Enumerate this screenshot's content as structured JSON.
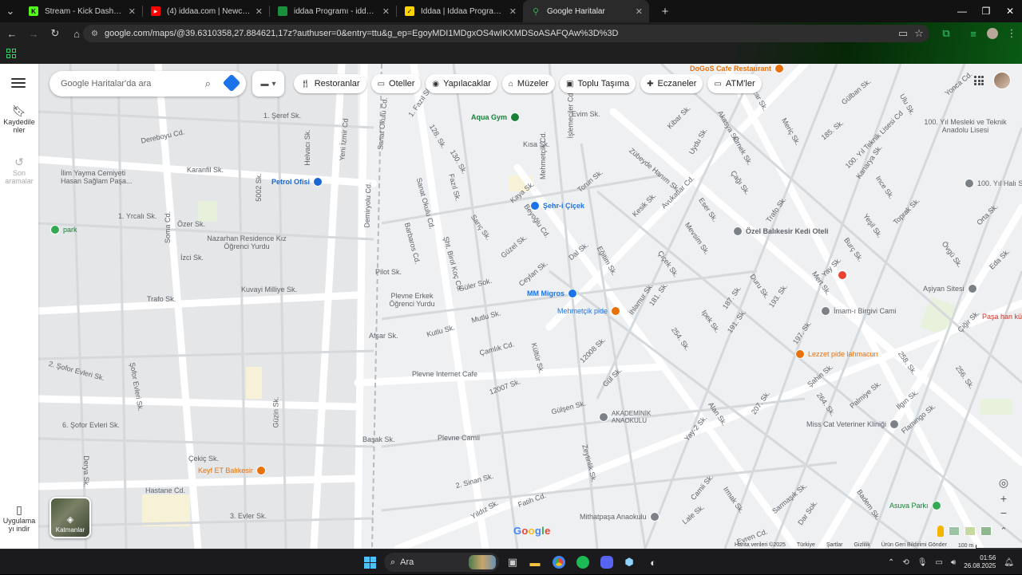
{
  "browser": {
    "tabs": [
      {
        "title": "Stream - Kick Dashboard",
        "fav_color": "#53fc18",
        "fav_glyph": "K",
        "active": false
      },
      {
        "title": "(4) iddaa.com | Newcastle (2-3)",
        "fav_color": "#ff0000",
        "fav_glyph": "▶",
        "active": false
      },
      {
        "title": "iddaa Programı - iddaa Bülten",
        "fav_color": "#1a8f3c",
        "fav_glyph": "",
        "active": false
      },
      {
        "title": "İddaa | İddaa Programı | Canlı İ...",
        "fav_color": "#ffd400",
        "fav_glyph": "✓",
        "active": false
      },
      {
        "title": "Google Haritalar",
        "fav_color": "#34a853",
        "fav_glyph": "",
        "active": true
      }
    ],
    "new_tab_label": "+",
    "url": "google.com/maps/@39.6310358,27.884621,17z?authuser=0&entry=ttu&g_ep=EgoyMDI1MDgxOS4wIKXMDSoASAFQAw%3D%3D"
  },
  "maps": {
    "rail": {
      "saved_label": "Kaydedilenler",
      "saved_l1": "Kaydedile",
      "saved_l2": "nler",
      "recent_l1": "Son",
      "recent_l2": "aramalar",
      "app_l1": "Uygulama",
      "app_l2": "yı indir"
    },
    "search_placeholder": "Google Haritalar'da ara",
    "chips": [
      {
        "label": "Restoranlar",
        "icon": "🍴"
      },
      {
        "label": "Oteller",
        "icon": "🛏"
      },
      {
        "label": "Yapılacaklar",
        "icon": "📷"
      },
      {
        "label": "Müzeler",
        "icon": "🏛"
      },
      {
        "label": "Toplu Taşıma",
        "icon": "🚆"
      },
      {
        "label": "Eczaneler",
        "icon": "💊"
      },
      {
        "label": "ATM'ler",
        "icon": "💳"
      }
    ],
    "layers_label": "Katmanlar",
    "google_logo": "Google",
    "attribution": [
      "Harita verileri ©2025",
      "Türkiye",
      "Şartlar",
      "Gizlilik",
      "Ürün Geri Bildirimi Gönder",
      "100 m"
    ],
    "places": [
      {
        "name": "DoGoS Cafe Restaurant",
        "color": "#e8710a"
      },
      {
        "name": "Aqua Gym",
        "color": "#188038"
      },
      {
        "name": "Petrol Ofisi",
        "color": "#1967d2"
      },
      {
        "name": "Şehr-i Çiçek",
        "color": "#1a73e8"
      },
      {
        "name": "Özel Balıkesir Kedi Oteli",
        "color": "#5f6368"
      },
      {
        "name": "Nazarhan Residence Kız Öğrenci Yurdu",
        "color": "#5f6368"
      },
      {
        "name": "İlim Yayma Cemiyeti Hasan Sağlam Paşa...",
        "color": "#5f6368"
      },
      {
        "name": "park",
        "color": "#188038"
      },
      {
        "name": "MM Migros",
        "color": "#1a73e8"
      },
      {
        "name": "Mehmetçik pide",
        "color": "#e8710a"
      },
      {
        "name": "Plevne Erkek Öğrenci Yurdu",
        "color": "#5f6368"
      },
      {
        "name": "Plevne Internet Cafe",
        "color": "#5f6368"
      },
      {
        "name": "Plevne Camii",
        "color": "#5f6368"
      },
      {
        "name": "AKADEMİNİK ANAOKULU",
        "color": "#5f6368"
      },
      {
        "name": "Mithatpaşa Anaokulu",
        "color": "#5f6368"
      },
      {
        "name": "Keyf ET Balıkesir",
        "color": "#e8710a"
      },
      {
        "name": "Lezzet pide lahmacun",
        "color": "#e8710a"
      },
      {
        "name": "İmam-ı Birgivi Cami",
        "color": "#5f6368"
      },
      {
        "name": "Aşiyan Sitesi",
        "color": "#5f6368"
      },
      {
        "name": "Paşa han kü",
        "color": "#d93025"
      },
      {
        "name": "Miss Cat Veteriner Kliniği",
        "color": "#5f6368"
      },
      {
        "name": "Asuva Parkı",
        "color": "#188038"
      },
      {
        "name": "100. Yıl Mesleki ve Teknik Anadolu Lisesi",
        "color": "#5f6368"
      },
      {
        "name": "100. Yıl Halı S",
        "color": "#5f6368"
      }
    ],
    "streets": [
      "1. Şeref Sk.",
      "Dereboyu Cd.",
      "Karanfil Sk.",
      "Helvacı Sk.",
      "Yeni İzmir Cd",
      "Sanat Okulu Cd.",
      "1. Fazıl Sk.",
      "Evim Sk.",
      "Kısa Sk.",
      "128. Sk.",
      "130. Sk.",
      "İşlemeciler Cd",
      "Kibar Sk.",
      "Akasya Sk.",
      "Pazar Sk.",
      "Gülban Sk.",
      "Yonca Cd.",
      "Ulu Sk.",
      "185. Sk.",
      "Meriç Sk.",
      "Örnek Sk.",
      "Uydu Sk.",
      "Zübeyde Hanım Sk.",
      "Avukatlar Cd.",
      "Torun Sk.",
      "Eğitim Sk.",
      "Kaya Sk.",
      "Beyoğlu Cd.",
      "Güzel Sk.",
      "Sarıç Sk.",
      "Fazıl Sk.",
      "Sanat Okulu Cd.",
      "Demiryolu Cd.",
      "1. Yrcalı Sk.",
      "Özer Sk.",
      "İzci Sk.",
      "Kuvayi Milliye Sk.",
      "Trafo Sk.",
      "Soma Cd.",
      "5002 Sk.",
      "Pilot Sk.",
      "Barbaros Cd.",
      "Şht. Birol Koç Cd.",
      "Ceylan Sk.",
      "Dal Sk.",
      "Kesik Sk.",
      "Çiçek Sk.",
      "Mevsim Sk.",
      "Güler Sok.",
      "Mutlu Sk.",
      "Kutlu Sk.",
      "Afşar Sk.",
      "Çamlık Cd.",
      "Kültür Sk.",
      "12008 Sk.",
      "12007 Sk.",
      "Gülşen Sk.",
      "Yıldız Sk.",
      "Başak Sk.",
      "2. Şofor Evleri Sk.",
      "Şofor Evleri Sk.",
      "6. Şofor Evleri Sk.",
      "Çekiç Sk.",
      "Hastane Cd.",
      "3. Evler Sk.",
      "Güzin Sk.",
      "Derya Sk.",
      "2. Sinan Sk.",
      "Fatih Cd.",
      "Camii Sk.",
      "Lale Sk.",
      "Sarmaşık Sk.",
      "Flamingo Sk.",
      "Palmiye Sk.",
      "Ilgın Sk.",
      "Şahin Sk.",
      "Alan Sk.",
      "Yay Sk.",
      "Mert Sk.",
      "Burç Sk.",
      "Yeşil Sk.",
      "Toprak Sk.",
      "Ince Sk.",
      "Kanarya Sk.",
      "100. Yıl Teknik Lisesi Cd",
      "Orta Sk.",
      "Eda Sk.",
      "Övgü Sk.",
      "Çiğir Sk.",
      "258. Sk.",
      "256. Sk.",
      "264. Sk.",
      "207. Sk.",
      "254. Sk.",
      "193. Sk.",
      "197. Sk.",
      "187. Sk.",
      "191. Sk.",
      "181. Sk.",
      "Ipek Sk.",
      "Duru Sk.",
      "Eser Sk.",
      "Çağı Sk.",
      "Trafo Sk.",
      "İhlamur Sk.",
      "Gül Sk.",
      "Zeytinlik Sk.",
      "Irmak Sk.",
      "Dar Sok.",
      "Badem Sk.",
      "Evren Cd.",
      "Mehmetçik Cd.",
      "Yay-2 Sk.",
      "Kaya Sk."
    ]
  },
  "taskbar": {
    "search_label": "Ara",
    "time": "01:56",
    "date": "26.08.2025",
    "accent": "#4cc2ff"
  }
}
